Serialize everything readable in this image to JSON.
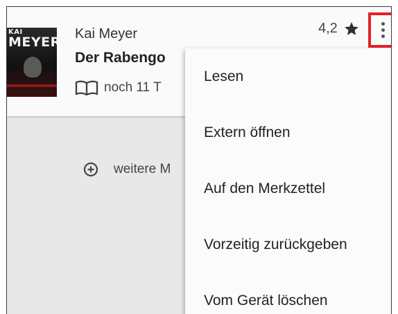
{
  "book": {
    "author": "Kai Meyer",
    "title": "Der Rabengo",
    "remaining": "noch 11 T",
    "rating": "4,2",
    "cover": {
      "line1": "KAI",
      "line2": "MEYER"
    }
  },
  "more_button": {
    "label": "weitere M"
  },
  "popup_menu": {
    "items": [
      {
        "label": "Lesen"
      },
      {
        "label": "Extern öffnen"
      },
      {
        "label": "Auf den Merkzettel"
      },
      {
        "label": "Vorzeitig zurückgeben"
      },
      {
        "label": "Vom Gerät löschen"
      }
    ]
  },
  "colors": {
    "highlight": "#e52028",
    "background": "#e8e8e8",
    "card": "#fafafa"
  },
  "icons": [
    "book-open-icon",
    "star-icon",
    "overflow-menu-icon",
    "plus-circle-icon"
  ]
}
